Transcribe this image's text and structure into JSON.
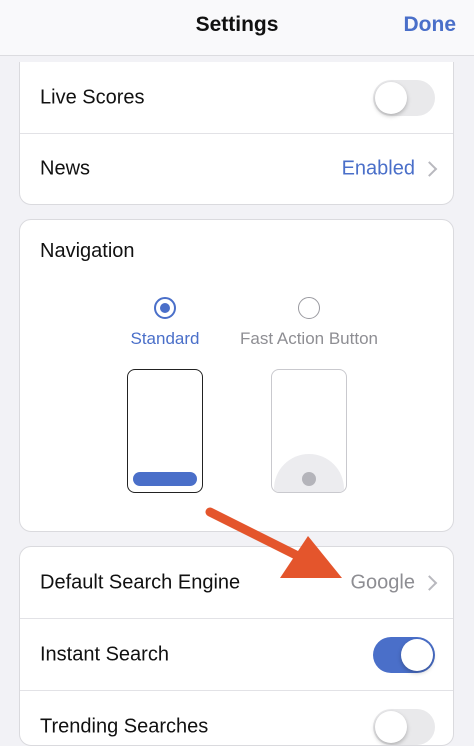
{
  "header": {
    "title": "Settings",
    "done_label": "Done"
  },
  "section_top": {
    "rows": [
      {
        "label": "Live Scores",
        "toggle": "off"
      },
      {
        "label": "News",
        "value": "Enabled"
      }
    ]
  },
  "navigation": {
    "title": "Navigation",
    "options": [
      {
        "label": "Standard",
        "selected": true
      },
      {
        "label": "Fast Action Button",
        "selected": false
      }
    ]
  },
  "section_search": {
    "rows": [
      {
        "label": "Default Search Engine",
        "value": "Google"
      },
      {
        "label": "Instant Search",
        "toggle": "on"
      },
      {
        "label": "Trending Searches",
        "toggle": "off"
      }
    ]
  },
  "colors": {
    "accent": "#4a6fc9",
    "annotation_arrow": "#e4552c",
    "secondary_text": "#8e8e93",
    "background": "#f2f2f6"
  },
  "icons": {
    "chevron": "chevron-right-icon",
    "annotation": "arrow-annotation-icon"
  }
}
